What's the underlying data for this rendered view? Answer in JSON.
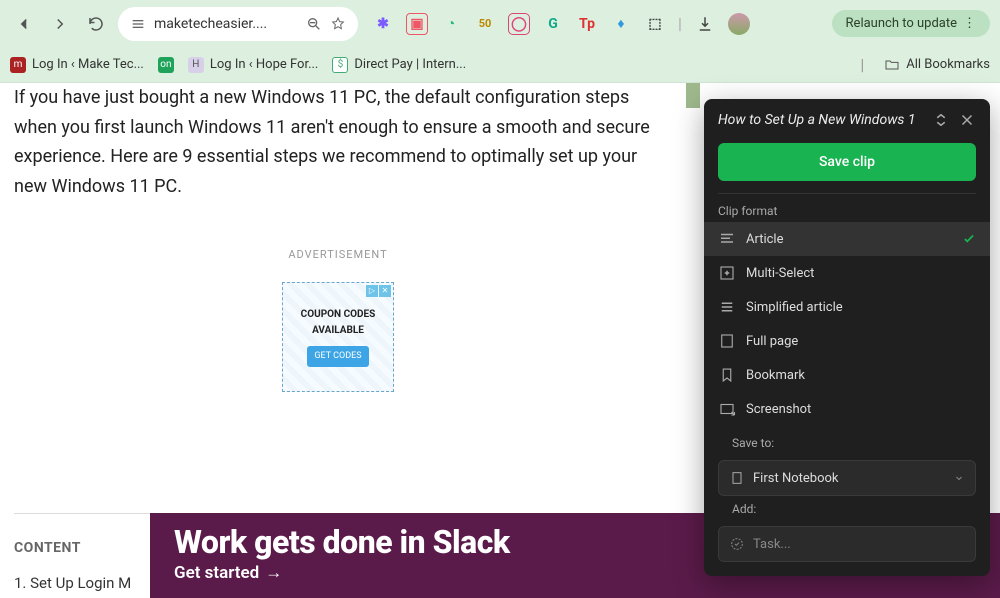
{
  "browser": {
    "url": "maketecheasier....",
    "relaunch": "Relaunch to update"
  },
  "bookmarks": {
    "items": [
      {
        "label": "Log In ‹ Make Tec...",
        "color": "#a22"
      },
      {
        "label": "",
        "color": "#1fa35a"
      },
      {
        "label": "Log In ‹ Hope For...",
        "color": "#d7d0e8"
      },
      {
        "label": "Direct Pay | Intern...",
        "color": "#4a7"
      }
    ],
    "all": "All Bookmarks"
  },
  "article": {
    "text": "If you have just bought a new Windows 11 PC, the default configuration steps when you first launch Windows 11 aren't enough to ensure a smooth and secure experience. Here are 9 essential steps we recommend to optimally set up your new Windows 11 PC.",
    "ad_label": "ADVERTISEMENT",
    "coupon_title": "COUPON CODES AVAILABLE",
    "coupon_btn": "GET CODES",
    "content_heading": "CONTENT",
    "content_item1": "1. Set Up Login M"
  },
  "slack": {
    "title": "Work gets done in Slack",
    "cta": "Get started"
  },
  "clipper": {
    "title": "How to Set Up a New Windows 1",
    "save": "Save clip",
    "format_label": "Clip format",
    "formats": [
      {
        "label": "Article",
        "selected": true
      },
      {
        "label": "Multi-Select",
        "selected": false
      },
      {
        "label": "Simplified article",
        "selected": false
      },
      {
        "label": "Full page",
        "selected": false
      },
      {
        "label": "Bookmark",
        "selected": false
      },
      {
        "label": "Screenshot",
        "selected": false
      }
    ],
    "save_to_label": "Save to:",
    "notebook": "First Notebook",
    "add_label": "Add:",
    "task_placeholder": "Task..."
  }
}
